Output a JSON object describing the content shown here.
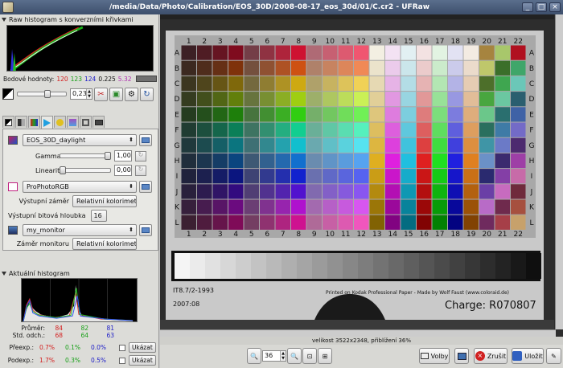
{
  "window": {
    "title": "/media/Data/Photo/Calibration/EOS_30D/2008-08-17_eos_30d/01/C.cr2 - UFRaw",
    "buttons": [
      "_",
      "□",
      "×"
    ]
  },
  "raw_histogram": {
    "header": "Raw histogram s konverzními křivkami"
  },
  "point_values": {
    "label": "Bodové hodnoty:",
    "r": "120",
    "g": "123",
    "b": "124",
    "x": "0.225",
    "y": "5.32",
    "swatch_color": "#707070"
  },
  "exposure": {
    "value": "0,23",
    "fraction": 0.62
  },
  "tabs": [
    "raw",
    "white-balance",
    "base",
    "color-management",
    "corrections",
    "lightness",
    "crop",
    "exif"
  ],
  "active_tab": 3,
  "color_mgmt": {
    "input_profile": "EOS_30D_daylight",
    "gamma_label": "Gamma",
    "gamma_value": "1,00",
    "linearity_label": "Linearita",
    "linearity_value": "0,00",
    "output_profile": "ProPhotoRGB",
    "output_intent_label": "Výstupní záměr",
    "output_intent": "Relativní kolorimetr",
    "bit_depth_label": "Výstupní bitová hloubka",
    "bit_depth": "16",
    "display_profile": "my_monitor",
    "monitor_intent_label": "Záměr monitoru",
    "monitor_intent": "Relativní kolorimetr"
  },
  "live_histogram": {
    "header": "Aktuální histogram",
    "average_label": "Průměr:",
    "average": [
      "84",
      "82",
      "81"
    ],
    "stddev_label": "Std. odch.:",
    "stddev": [
      "68",
      "64",
      "63"
    ],
    "overexp_label": "Přeexp.:",
    "overexp": [
      "0.7%",
      "0.1%",
      "0.0%"
    ],
    "underexp_label": "Podexp.:",
    "underexp": [
      "1.7%",
      "0.3%",
      "0.5%"
    ],
    "show_label": "Ukázat",
    "colors": {
      "r": "#d42020",
      "g": "#18a018",
      "b": "#2020c8"
    }
  },
  "chart": {
    "columns": [
      "1",
      "2",
      "3",
      "4",
      "5",
      "6",
      "7",
      "8",
      "9",
      "10",
      "11",
      "12",
      "13",
      "14",
      "15",
      "16",
      "17",
      "18",
      "19",
      "20",
      "21",
      "22"
    ],
    "rows": [
      "A",
      "B",
      "C",
      "D",
      "E",
      "F",
      "G",
      "H",
      "I",
      "J",
      "K",
      "L"
    ],
    "left_text": "IT8.7/2-1993",
    "left_date": "2007:08",
    "printed_text": "Printed on Kodak Professional Paper  -  Made by Wolf Faust (www.coloraid.de)",
    "charge_text": "Charge: R070807"
  },
  "status": {
    "size_text": "velikost 3522x2348, přiblížení 36%"
  },
  "bottom": {
    "zoom_value": "36",
    "options_label": "Volby",
    "cancel_label": "Zrušit",
    "save_label": "Uložit"
  }
}
